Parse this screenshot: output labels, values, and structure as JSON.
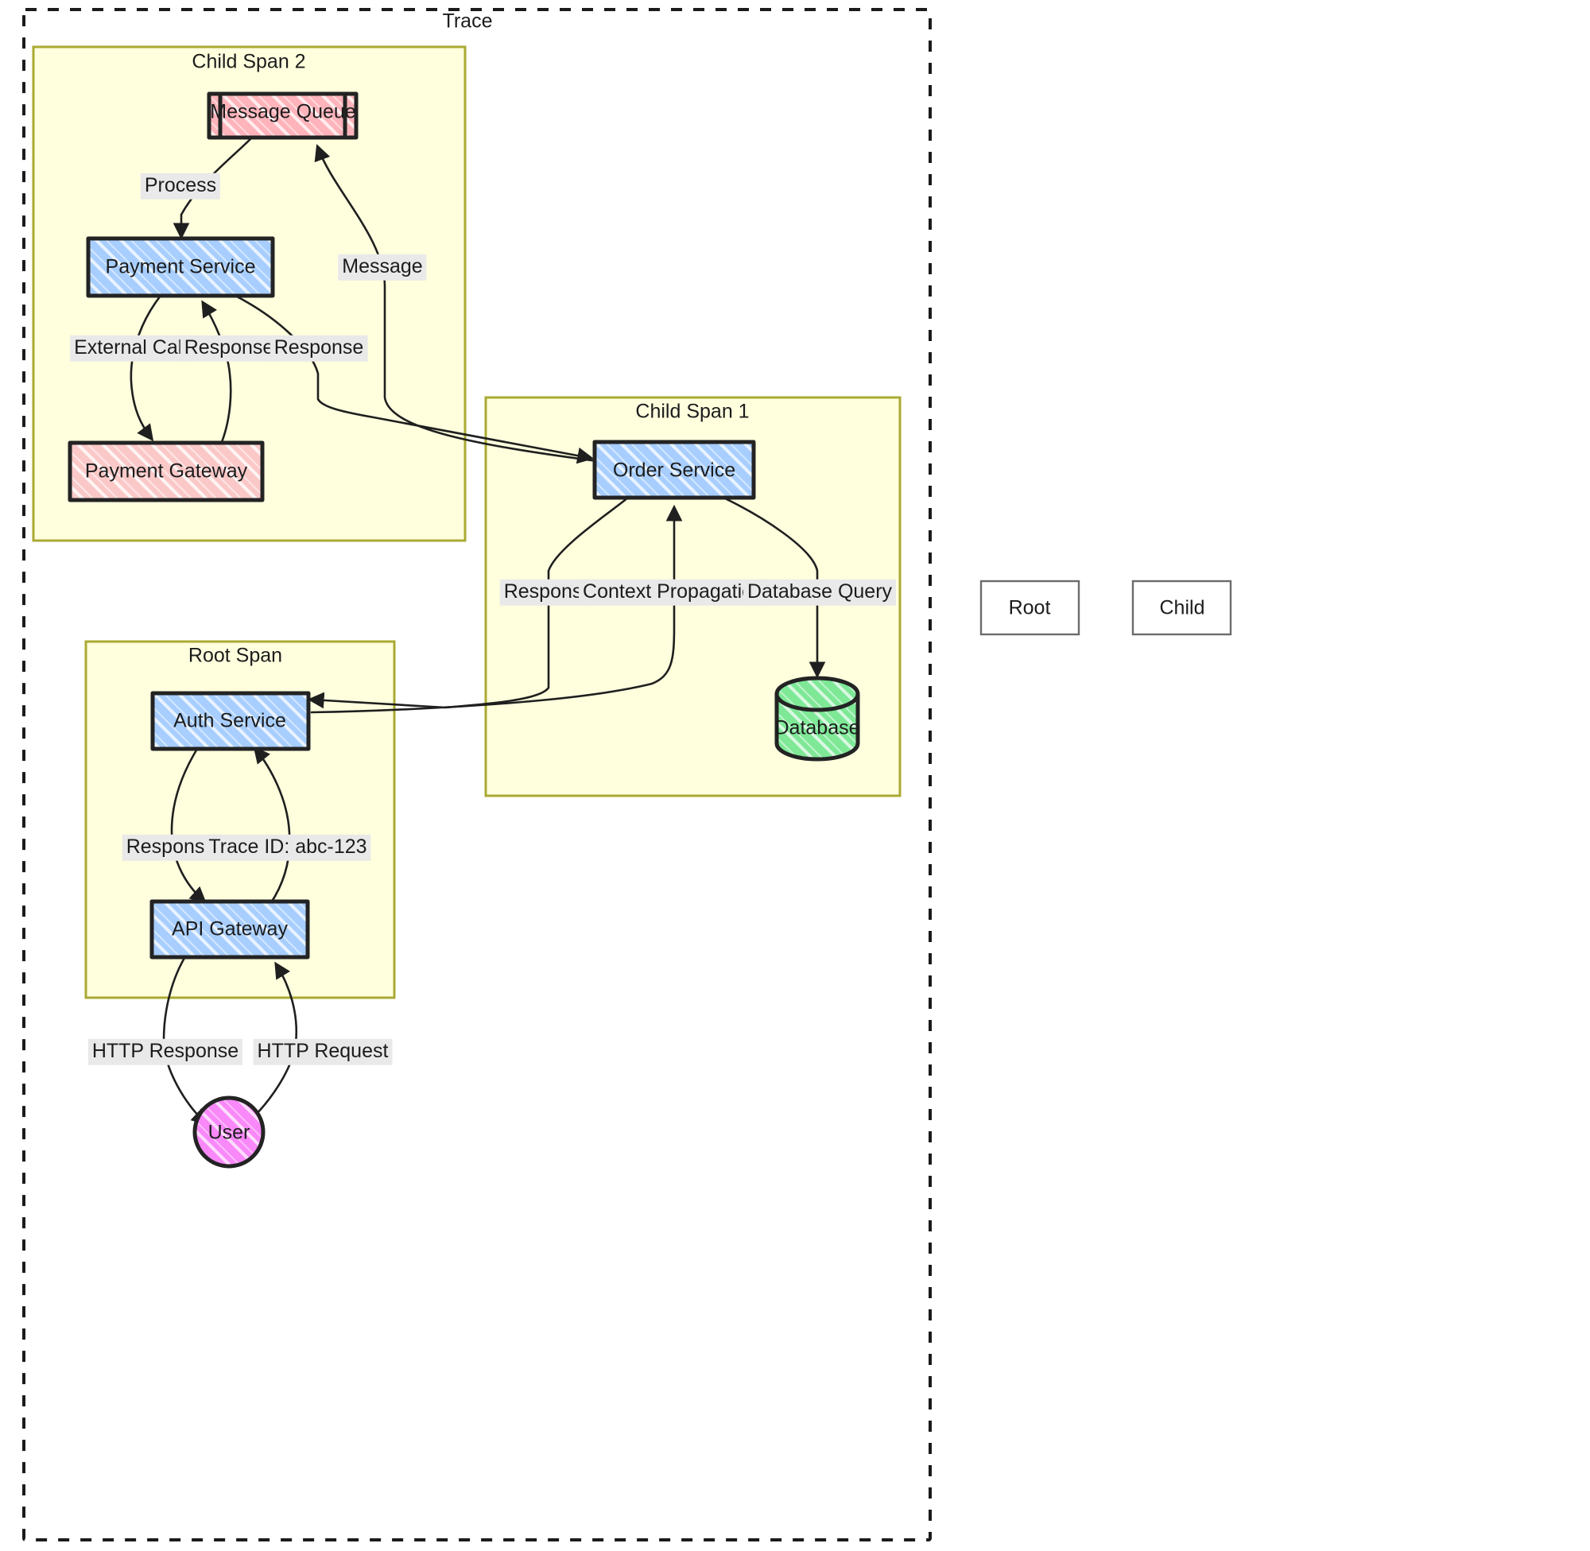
{
  "diagram": {
    "title": "Trace",
    "type": "distributed-tracing-flowchart"
  },
  "trace": {
    "label": "Trace"
  },
  "spans": [
    {
      "id": "child-span-2",
      "label": "Child Span 2"
    },
    {
      "id": "child-span-1",
      "label": "Child Span 1"
    },
    {
      "id": "root-span",
      "label": "Root Span"
    }
  ],
  "nodes": [
    {
      "id": "message-queue",
      "label": "Message Queue",
      "shape": "subroutine",
      "fill": "#ffb3ba",
      "stroke": "#232323",
      "span": "child-span-2"
    },
    {
      "id": "payment-service",
      "label": "Payment Service",
      "shape": "rect",
      "fill": "#a7ceff",
      "stroke": "#232323",
      "span": "child-span-2"
    },
    {
      "id": "payment-gateway",
      "label": "Payment Gateway",
      "shape": "rect",
      "fill": "#fbc8c8",
      "stroke": "#232323",
      "span": "child-span-2"
    },
    {
      "id": "order-service",
      "label": "Order Service",
      "shape": "rect",
      "fill": "#a7ceff",
      "stroke": "#232323",
      "span": "child-span-1"
    },
    {
      "id": "database",
      "label": "Database",
      "shape": "cylinder",
      "fill": "#7ee897",
      "stroke": "#232323",
      "span": "child-span-1"
    },
    {
      "id": "auth-service",
      "label": "Auth Service",
      "shape": "rect",
      "fill": "#a7ceff",
      "stroke": "#232323",
      "span": "root-span"
    },
    {
      "id": "api-gateway",
      "label": "API Gateway",
      "shape": "rect",
      "fill": "#a7ceff",
      "stroke": "#232323",
      "span": "root-span"
    },
    {
      "id": "user",
      "label": "User",
      "shape": "circle",
      "fill": "#f988f9",
      "stroke": "#232323",
      "span": null
    }
  ],
  "edges": [
    {
      "id": "e-process",
      "from": "message-queue",
      "to": "payment-service",
      "label": "Process"
    },
    {
      "id": "e-message",
      "from": "order-service",
      "to": "message-queue",
      "label": "Message"
    },
    {
      "id": "e-extcall",
      "from": "payment-service",
      "to": "payment-gateway",
      "label": "External Call"
    },
    {
      "id": "e-resp-pg",
      "from": "payment-gateway",
      "to": "payment-service",
      "label": "Response"
    },
    {
      "id": "e-resp-ps",
      "from": "payment-service",
      "to": "order-service",
      "label": "Response"
    },
    {
      "id": "e-resp-os",
      "from": "order-service",
      "to": "auth-service",
      "label": "Response"
    },
    {
      "id": "e-ctx-prop",
      "from": "auth-service",
      "to": "order-service",
      "label": "Context Propagation"
    },
    {
      "id": "e-db-query",
      "from": "order-service",
      "to": "database",
      "label": "Database Query"
    },
    {
      "id": "e-resp-auth",
      "from": "auth-service",
      "to": "api-gateway",
      "label": "Response"
    },
    {
      "id": "e-trace-id",
      "from": "api-gateway",
      "to": "auth-service",
      "label": "Trace ID: abc-123"
    },
    {
      "id": "e-http-resp",
      "from": "api-gateway",
      "to": "user",
      "label": "HTTP Response"
    },
    {
      "id": "e-http-req",
      "from": "user",
      "to": "api-gateway",
      "label": "HTTP Request"
    }
  ],
  "legend": [
    {
      "id": "legend-root",
      "label": "Root"
    },
    {
      "id": "legend-child",
      "label": "Child"
    }
  ],
  "colors": {
    "span_fill": "#ffffde",
    "span_stroke": "#aaaa33",
    "trace_stroke": "#1b1b1b",
    "service_fill": "#a7ceff",
    "queue_fill": "#ffb3ba",
    "gateway_fill": "#fbc8c8",
    "database_fill": "#7ee897",
    "user_fill": "#f988f9",
    "edge_stroke": "#1f1f1f",
    "edge_label_bg": "#e9e9e9",
    "legend_stroke": "#6b6b6b"
  }
}
